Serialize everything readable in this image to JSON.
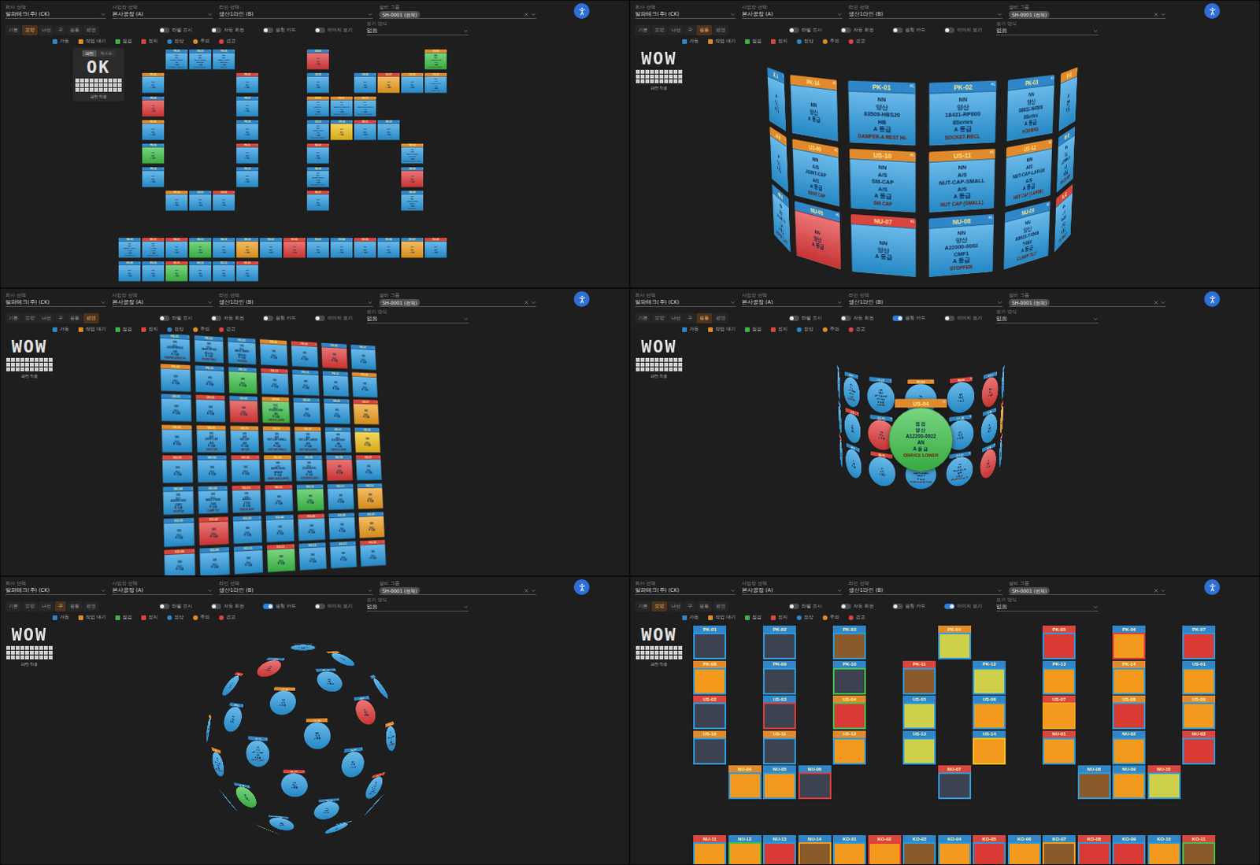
{
  "toolbar": {
    "fields": [
      {
        "label": "회사 선택",
        "value": "알파테크(주) (CK)",
        "chip": false,
        "clearable": false
      },
      {
        "label": "사업장 선택",
        "value": "본사공장 (A)",
        "chip": false,
        "clearable": false
      },
      {
        "label": "라인 선택",
        "value": "생산1라인 (B)",
        "chip": false,
        "clearable": false
      },
      {
        "label": "설비 그룹",
        "value": "SH-0001 (전체)",
        "chip": true,
        "clearable": true
      }
    ],
    "view": {
      "label": "보기 방식",
      "value": "없음"
    }
  },
  "legend": [
    {
      "label": "가동",
      "color": "#2f86c9",
      "kind": "square"
    },
    {
      "label": "작업 대기",
      "color": "#e08a2c",
      "kind": "square"
    },
    {
      "label": "점검",
      "color": "#3fb24a",
      "kind": "square"
    },
    {
      "label": "정지",
      "color": "#d9453f",
      "kind": "square"
    },
    {
      "label": "정상",
      "color": "#2f86c9",
      "kind": "dot"
    },
    {
      "label": "주의",
      "color": "#e08a2c",
      "kind": "dot"
    },
    {
      "label": "경고",
      "color": "#d9453f",
      "kind": "dot"
    }
  ],
  "panels": [
    {
      "kind": "ok-pattern",
      "logo": {
        "tabs": [
          {
            "label": "패턴",
            "selected": true
          },
          {
            "label": "텍스트",
            "selected": false
          }
        ],
        "text": "OK",
        "caption": "패턴 적용"
      },
      "tabs": [
        {
          "label": "기본",
          "selected": false
        },
        {
          "label": "모양",
          "selected": true
        },
        {
          "label": "나선",
          "selected": false
        },
        {
          "label": "구",
          "selected": false
        },
        {
          "label": "원통",
          "selected": false
        },
        {
          "label": "평면",
          "selected": false
        }
      ],
      "toggles": [
        {
          "label": "라벨 표시",
          "on": false
        },
        {
          "label": "자동 회전",
          "on": false
        },
        {
          "label": "원형 카드",
          "on": false
        },
        {
          "label": "이미지 보기",
          "on": false
        }
      ]
    },
    {
      "kind": "ring",
      "logo": {
        "tabs": [],
        "text": "WOW",
        "caption": "패턴 적용"
      },
      "tabs": [
        {
          "label": "기본",
          "selected": false
        },
        {
          "label": "모양",
          "selected": false
        },
        {
          "label": "나선",
          "selected": false
        },
        {
          "label": "구",
          "selected": false
        },
        {
          "label": "원통",
          "selected": true
        },
        {
          "label": "평면",
          "selected": false
        }
      ],
      "toggles": [
        {
          "label": "라벨 표시",
          "on": false
        },
        {
          "label": "자동 회전",
          "on": false
        },
        {
          "label": "원형 카드",
          "on": false
        },
        {
          "label": "이미지 보기",
          "on": false
        }
      ]
    },
    {
      "kind": "grid",
      "logo": {
        "tabs": [],
        "text": "WOW",
        "caption": "패턴 적용"
      },
      "tabs": [
        {
          "label": "기본",
          "selected": false
        },
        {
          "label": "모양",
          "selected": false
        },
        {
          "label": "나선",
          "selected": false
        },
        {
          "label": "구",
          "selected": false
        },
        {
          "label": "원통",
          "selected": false
        },
        {
          "label": "평면",
          "selected": true
        }
      ],
      "toggles": [
        {
          "label": "라벨 표시",
          "on": false
        },
        {
          "label": "자동 회전",
          "on": false
        },
        {
          "label": "원형 카드",
          "on": false
        },
        {
          "label": "이미지 보기",
          "on": false
        }
      ]
    },
    {
      "kind": "ring",
      "focus": "US-04",
      "logo": {
        "tabs": [],
        "text": "WOW",
        "caption": "패턴 적용"
      },
      "tabs": [
        {
          "label": "기본",
          "selected": false
        },
        {
          "label": "모양",
          "selected": false
        },
        {
          "label": "나선",
          "selected": false
        },
        {
          "label": "구",
          "selected": false
        },
        {
          "label": "원통",
          "selected": true
        },
        {
          "label": "평면",
          "selected": false
        }
      ],
      "toggles": [
        {
          "label": "라벨 표시",
          "on": false
        },
        {
          "label": "자동 회전",
          "on": false
        },
        {
          "label": "원형 카드",
          "on": true
        },
        {
          "label": "이미지 보기",
          "on": false
        }
      ]
    },
    {
      "kind": "sphere",
      "logo": {
        "tabs": [],
        "text": "WOW",
        "caption": "패턴 적용"
      },
      "tabs": [
        {
          "label": "기본",
          "selected": false
        },
        {
          "label": "모양",
          "selected": false
        },
        {
          "label": "나선",
          "selected": false
        },
        {
          "label": "구",
          "selected": true
        },
        {
          "label": "원통",
          "selected": false
        },
        {
          "label": "평면",
          "selected": false
        }
      ],
      "toggles": [
        {
          "label": "라벨 표시",
          "on": false
        },
        {
          "label": "자동 회전",
          "on": false
        },
        {
          "label": "원형 카드",
          "on": true
        },
        {
          "label": "이미지 보기",
          "on": false
        }
      ]
    },
    {
      "kind": "wow-pattern",
      "logo": {
        "tabs": [],
        "text": "WOW",
        "caption": "패턴 적용"
      },
      "tabs": [
        {
          "label": "기본",
          "selected": false
        },
        {
          "label": "모양",
          "selected": true
        },
        {
          "label": "나선",
          "selected": false
        },
        {
          "label": "구",
          "selected": false
        },
        {
          "label": "원통",
          "selected": false
        },
        {
          "label": "평면",
          "selected": false
        }
      ],
      "toggles": [
        {
          "label": "라벨 표시",
          "on": false
        },
        {
          "label": "자동 회전",
          "on": false
        },
        {
          "label": "원형 카드",
          "on": false
        },
        {
          "label": "이미지 보기",
          "on": true
        }
      ]
    }
  ],
  "cards": [
    {
      "id": "PK-01",
      "badge": "#1",
      "header_color": "#2f86c9",
      "color": "#2a9be0",
      "picture": "#3d4250",
      "lines": [
        "NN",
        "양산",
        "83509-HBS20",
        "HB",
        "A 등급"
      ],
      "name": "DAMPER-A REST HI-"
    },
    {
      "id": "PK-02",
      "badge": "#1",
      "header_color": "#2f86c9",
      "color": "#2a9be0",
      "picture": "#3d4250",
      "lines": [
        "NN",
        "양산",
        "18431-RP800",
        "8Series",
        "A 등급"
      ],
      "name": "SOCKET-RECL"
    },
    {
      "id": "PK-03",
      "badge": "#1",
      "header_color": "#2f86c9",
      "color": "#2a9be0",
      "picture": "#8b5a2b",
      "lines": [
        "NN",
        "양산",
        "88811-N4500",
        "8Series",
        "A 등급"
      ],
      "name": "HOUSING"
    },
    {
      "id": "PK-04",
      "badge": "#1",
      "header_color": "#e08a2c",
      "color": "#2a9be0",
      "picture": "#cfd04a",
      "lines": [
        "NN",
        "양산",
        "A 등급"
      ]
    },
    {
      "id": "PK-05",
      "badge": "#1",
      "header_color": "#d9453f",
      "color": "#2a9be0",
      "picture": "#d93a34",
      "lines": [
        "NN",
        "양산",
        "A 등급"
      ]
    },
    {
      "id": "PK-06",
      "badge": "#1",
      "header_color": "#2f86c9",
      "color": "#e23b3b",
      "picture": "#f39a1e",
      "lines": [
        "NN",
        "양산",
        "A 등급"
      ]
    },
    {
      "id": "PK-07",
      "badge": "#1",
      "header_color": "#2f86c9",
      "color": "#2a9be0",
      "picture": "#d93a34",
      "lines": [
        "NN",
        "양산",
        "A 등급"
      ]
    },
    {
      "id": "PK-08",
      "badge": "#1",
      "header_color": "#e08a2c",
      "color": "#2a9be0",
      "picture": "#f39a1e",
      "lines": [
        "NN",
        "양산",
        "A 등급"
      ]
    },
    {
      "id": "PK-09",
      "badge": "#1",
      "header_color": "#2f86c9",
      "color": "#2a9be0",
      "picture": "#3d4250",
      "lines": [
        "NN",
        "양산",
        "A 등급"
      ]
    },
    {
      "id": "PK-10",
      "badge": "#1",
      "header_color": "#2f86c9",
      "color": "#3fc24a",
      "picture": "#3d4250",
      "lines": [
        "NN",
        "양산",
        "A 등급"
      ]
    },
    {
      "id": "PK-11",
      "badge": "#1",
      "header_color": "#d9453f",
      "color": "#2a9be0",
      "picture": "#8b5a2b",
      "lines": [
        "NN",
        "양산",
        "A 등급"
      ]
    },
    {
      "id": "PK-12",
      "badge": "#1",
      "header_color": "#2f86c9",
      "color": "#2a9be0",
      "picture": "#cfd04a",
      "lines": [
        "NN",
        "양산",
        "A 등급"
      ]
    },
    {
      "id": "PK-13",
      "badge": "#1",
      "header_color": "#2f86c9",
      "color": "#2a9be0",
      "picture": "#f39a1e",
      "lines": [
        "NN",
        "양산",
        "A 등급"
      ]
    },
    {
      "id": "PK-14",
      "badge": "#1",
      "header_color": "#e08a2c",
      "color": "#2a9be0",
      "picture": "#f39a1e",
      "lines": [
        "NN",
        "양산",
        "A 등급"
      ]
    },
    {
      "id": "US-01",
      "badge": "#1",
      "header_color": "#2f86c9",
      "color": "#2a9be0",
      "picture": "#f39a1e",
      "lines": [
        "NN",
        "양산",
        "A 등급"
      ]
    },
    {
      "id": "US-02",
      "badge": "#1",
      "header_color": "#d9453f",
      "color": "#2a9be0",
      "picture": "#3d4250",
      "lines": [
        "NN",
        "양산",
        "A 등급"
      ]
    },
    {
      "id": "US-03",
      "badge": "#1",
      "header_color": "#2f86c9",
      "color": "#e23b3b",
      "picture": "#3d4250",
      "lines": [
        "NN",
        "양산",
        "A 등급"
      ]
    },
    {
      "id": "US-04",
      "badge": "#1",
      "header_color": "#e08a2c",
      "color": "#3fc24a",
      "picture": "#d93a34",
      "lines": [
        "점검",
        "양산",
        "A12200-0022",
        "AN",
        "A 등급"
      ],
      "name": "ORIFICE LOWER"
    },
    {
      "id": "US-05",
      "badge": "#1",
      "header_color": "#2f86c9",
      "color": "#2a9be0",
      "picture": "#cfd04a",
      "lines": [
        "NN",
        "양산",
        "A 등급"
      ]
    },
    {
      "id": "US-06",
      "badge": "#1",
      "header_color": "#2f86c9",
      "color": "#2a9be0",
      "picture": "#f39a1e",
      "lines": [
        "NN",
        "양산",
        "A 등급"
      ]
    },
    {
      "id": "US-07",
      "badge": "#1",
      "header_color": "#d9453f",
      "color": "#f0a020",
      "picture": "#f39a1e",
      "lines": [
        "NN",
        "양산",
        "A 등급"
      ]
    },
    {
      "id": "US-08",
      "badge": "#1",
      "header_color": "#e08a2c",
      "color": "#2a9be0",
      "picture": "#d93a34",
      "lines": [
        "NN",
        "양산",
        "A 등급"
      ]
    },
    {
      "id": "US-09",
      "badge": "#1",
      "header_color": "#e08a2c",
      "color": "#2a9be0",
      "picture": "#f39a1e",
      "lines": [
        "NN",
        "A/S",
        "JOINT-CAP",
        "A/S",
        "A 등급"
      ],
      "name": "JOINT CAP"
    },
    {
      "id": "US-10",
      "badge": "#1",
      "header_color": "#e08a2c",
      "color": "#2a9be0",
      "picture": "#3d4250",
      "lines": [
        "NN",
        "A/S",
        "SM-CAP",
        "A/S",
        "A 등급"
      ],
      "name": "SM CAP"
    },
    {
      "id": "US-11",
      "badge": "#1",
      "header_color": "#e08a2c",
      "color": "#2a9be0",
      "picture": "#3d4250",
      "lines": [
        "NN",
        "A/S",
        "NUT-CAP-SMALL",
        "A/S",
        "A 등급"
      ],
      "name": "NUT CAP (SMALL)"
    },
    {
      "id": "US-12",
      "badge": "#1",
      "header_color": "#e08a2c",
      "color": "#2a9be0",
      "picture": "#f39a1e",
      "lines": [
        "NN",
        "A/S",
        "NUT-CAP-LARGE",
        "A/S",
        "A 등급"
      ],
      "name": "NUT CAP (LARGE)"
    },
    {
      "id": "US-13",
      "badge": "#1",
      "header_color": "#2f86c9",
      "color": "#2a9be0",
      "picture": "#cfd04a",
      "lines": [
        "NN",
        "양산",
        "A12200-0070",
        "AB",
        "A 등급"
      ],
      "name": "ORIFICE LOWER"
    },
    {
      "id": "US-14",
      "badge": "#1",
      "header_color": "#2f86c9",
      "color": "#f2c21a",
      "picture": "#f39a1e",
      "lines": [
        "NN",
        "양산",
        "A 등급"
      ]
    },
    {
      "id": "NU-01",
      "badge": "#1",
      "header_color": "#d9453f",
      "color": "#2a9be0",
      "picture": "#f39a1e",
      "lines": [
        "NN",
        "양산",
        "A 등급"
      ]
    },
    {
      "id": "NU-02",
      "badge": "#1",
      "header_color": "#2f86c9",
      "color": "#2a9be0",
      "picture": "#f39a1e",
      "lines": [
        "NN",
        "양산",
        "A 등급"
      ]
    },
    {
      "id": "NU-03",
      "badge": "#1",
      "header_color": "#d9453f",
      "color": "#2a9be0",
      "picture": "#d93a34",
      "lines": [
        "NN",
        "양산",
        "A 등급"
      ]
    },
    {
      "id": "NU-04",
      "badge": "#1",
      "header_color": "#e08a2c",
      "color": "#2a9be0",
      "picture": "#f39a1e",
      "lines": [
        "NN",
        "시작",
        "930PK-00000",
        "GRACE",
        "A 등급"
      ],
      "name": "INNER CASE (LARGE)"
    },
    {
      "id": "NU-05",
      "badge": "#1",
      "header_color": "#2f86c9",
      "color": "#2a9be0",
      "picture": "#f39a1e",
      "lines": [
        "NN",
        "양산",
        "55160-A3100",
        "TAM",
        "A 등급"
      ],
      "name": "STOPPER PLASTIC"
    },
    {
      "id": "NU-06",
      "badge": "#1",
      "header_color": "#2f86c9",
      "color": "#e23b3b",
      "picture": "#3d4250",
      "lines": [
        "NN",
        "양산",
        "A 등급"
      ]
    },
    {
      "id": "NU-07",
      "badge": "#1",
      "header_color": "#d9453f",
      "color": "#2a9be0",
      "picture": "#3d4250",
      "lines": [
        "NN",
        "양산",
        "A 등급"
      ]
    },
    {
      "id": "NU-08",
      "badge": "#1",
      "header_color": "#2f86c9",
      "color": "#2a9be0",
      "picture": "#8b5a2b",
      "lines": [
        "NN",
        "양산",
        "A22000-0002",
        "CMF1",
        "A 등급"
      ],
      "name": "STOPPER"
    },
    {
      "id": "NU-09",
      "badge": "#1",
      "header_color": "#2f86c9",
      "color": "#2a9be0",
      "picture": "#f39a1e",
      "lines": [
        "NN",
        "양산",
        "88923-Y4540",
        "Y400",
        "A 등급"
      ],
      "name": "CLAMP TILT"
    },
    {
      "id": "NU-10",
      "badge": "#1",
      "header_color": "#d9453f",
      "color": "#2a9be0",
      "picture": "#cfd04a",
      "lines": [
        "NN",
        "시작",
        "A44000",
        "CY00",
        "A 등급"
      ],
      "name": "STATOR ASSY"
    },
    {
      "id": "NU-11",
      "badge": "#1",
      "header_color": "#d9453f",
      "color": "#2a9be0",
      "picture": "#f39a1e",
      "lines": [
        "NN",
        "양산",
        "A 등급"
      ]
    },
    {
      "id": "NU-12",
      "badge": "#1",
      "header_color": "#2f86c9",
      "color": "#3fc24a",
      "picture": "#f39a1e",
      "lines": [
        "NN",
        "양산",
        "A 등급"
      ]
    },
    {
      "id": "NU-13",
      "badge": "#1",
      "header_color": "#2f86c9",
      "color": "#2a9be0",
      "picture": "#d93a34",
      "lines": [
        "NN",
        "양산",
        "A 등급"
      ]
    },
    {
      "id": "NU-14",
      "badge": "#1",
      "header_color": "#2f86c9",
      "color": "#f0a020",
      "picture": "#8b5a2b",
      "lines": [
        "NN",
        "양산",
        "A 등급"
      ]
    },
    {
      "id": "KO-01",
      "badge": "#1",
      "header_color": "#2f86c9",
      "color": "#2a9be0",
      "picture": "#f39a1e",
      "lines": [
        "NN",
        "양산",
        "A 등급"
      ]
    },
    {
      "id": "KO-02",
      "badge": "#1",
      "header_color": "#d9453f",
      "color": "#e23b3b",
      "picture": "#f39a1e",
      "lines": [
        "NN",
        "양산",
        "A 등급"
      ]
    },
    {
      "id": "KO-03",
      "badge": "#1",
      "header_color": "#2f86c9",
      "color": "#2a9be0",
      "picture": "#8b5a2b",
      "lines": [
        "NN",
        "양산",
        "A 등급"
      ]
    },
    {
      "id": "KO-04",
      "badge": "#1",
      "header_color": "#2f86c9",
      "color": "#2a9be0",
      "picture": "#f39a1e",
      "lines": [
        "NN",
        "양산",
        "A 등급"
      ]
    },
    {
      "id": "KO-05",
      "badge": "#1",
      "header_color": "#d9453f",
      "color": "#2a9be0",
      "picture": "#d93a34",
      "lines": [
        "NN",
        "양산",
        "A 등급"
      ]
    },
    {
      "id": "KO-06",
      "badge": "#1",
      "header_color": "#2f86c9",
      "color": "#2a9be0",
      "picture": "#f39a1e",
      "lines": [
        "NN",
        "양산",
        "A 등급"
      ]
    },
    {
      "id": "KO-07",
      "badge": "#1",
      "header_color": "#2f86c9",
      "color": "#f0a020",
      "picture": "#8b5a2b",
      "lines": [
        "NN",
        "양산",
        "A 등급"
      ]
    },
    {
      "id": "KO-08",
      "badge": "#1",
      "header_color": "#d9453f",
      "color": "#2a9be0",
      "picture": "#d93a34",
      "lines": [
        "NN",
        "양산",
        "A 등급"
      ]
    },
    {
      "id": "KO-09",
      "badge": "#1",
      "header_color": "#2f86c9",
      "color": "#2a9be0",
      "picture": "#d93a34",
      "lines": [
        "NN",
        "양산",
        "A 등급"
      ]
    },
    {
      "id": "KO-10",
      "badge": "#1",
      "header_color": "#2f86c9",
      "color": "#2a9be0",
      "picture": "#f39a1e",
      "lines": [
        "NN",
        "양산",
        "A 등급"
      ]
    },
    {
      "id": "KO-11",
      "badge": "#1",
      "header_color": "#d9453f",
      "color": "#3fc24a",
      "picture": "#8b5a2b",
      "lines": [
        "NN",
        "양산",
        "A 등급"
      ]
    },
    {
      "id": "KO-12",
      "badge": "#1",
      "header_color": "#2f86c9",
      "color": "#2a9be0",
      "picture": "#f39a1e",
      "lines": [
        "NN",
        "양산",
        "A 등급"
      ]
    },
    {
      "id": "KO-13",
      "badge": "#1",
      "header_color": "#2f86c9",
      "color": "#2a9be0",
      "picture": "#f39a1e",
      "lines": [
        "NN",
        "양산",
        "A 등급"
      ]
    },
    {
      "id": "KO-14",
      "badge": "#1",
      "header_color": "#d9453f",
      "color": "#2a9be0",
      "picture": "#8b5a2b",
      "lines": [
        "NN",
        "양산",
        "A 등급"
      ]
    }
  ]
}
